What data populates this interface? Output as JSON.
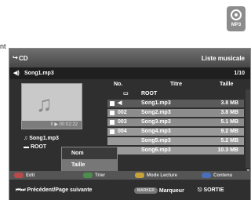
{
  "badge": {
    "icon": "disc-icon",
    "label": "MP3"
  },
  "edge_text": "nt",
  "header": {
    "icon": "cd-icon",
    "title": "CD",
    "right_title": "Liste musicale"
  },
  "now_playing": {
    "icon": "speaker-icon",
    "title": "Song1.mp3",
    "counter": "1/10"
  },
  "thumbnail": {
    "icon": "music-note-icon",
    "time": "II ▶ 00:02:22"
  },
  "left_info": {
    "song": "Song1.mp3",
    "folder": "ROOT"
  },
  "popup": {
    "items": [
      "Nom",
      "Taille"
    ]
  },
  "table": {
    "headers": {
      "no": "No.",
      "title": "Titre",
      "size": "Taille"
    },
    "rows": [
      {
        "no": "",
        "title": "ROOT",
        "size": "",
        "icon": "folder-icon"
      },
      {
        "no": "◀",
        "title": "Song1.mp3",
        "size": "3.8 MB"
      },
      {
        "no": "002",
        "title": "Song2.mp3",
        "size": "3.8 MB"
      },
      {
        "no": "003",
        "title": "Song3.mp3",
        "size": "5.1 MB"
      },
      {
        "no": "004",
        "title": "Song4.mp3",
        "size": "9.2 MB"
      },
      {
        "no": "",
        "title": "Song5.mp3",
        "size": "5.2 MB"
      },
      {
        "no": "",
        "title": "Song6.mp3",
        "size": "10.3 MB"
      }
    ]
  },
  "colorbar": {
    "edit": "Edit",
    "sort": "Trier",
    "mode": "Mode Lecture",
    "content": "Contenu"
  },
  "footer": {
    "prev_next": "Précédent/Page suivante",
    "marker_key": "MARKER",
    "marker": "Marqueur",
    "exit": "SORTIE"
  },
  "colors": {
    "edit_key": "#b84a4a",
    "sort_key": "#4c8f4c",
    "mode_key": "#c6a23a",
    "content_key": "#4a6fb8"
  }
}
